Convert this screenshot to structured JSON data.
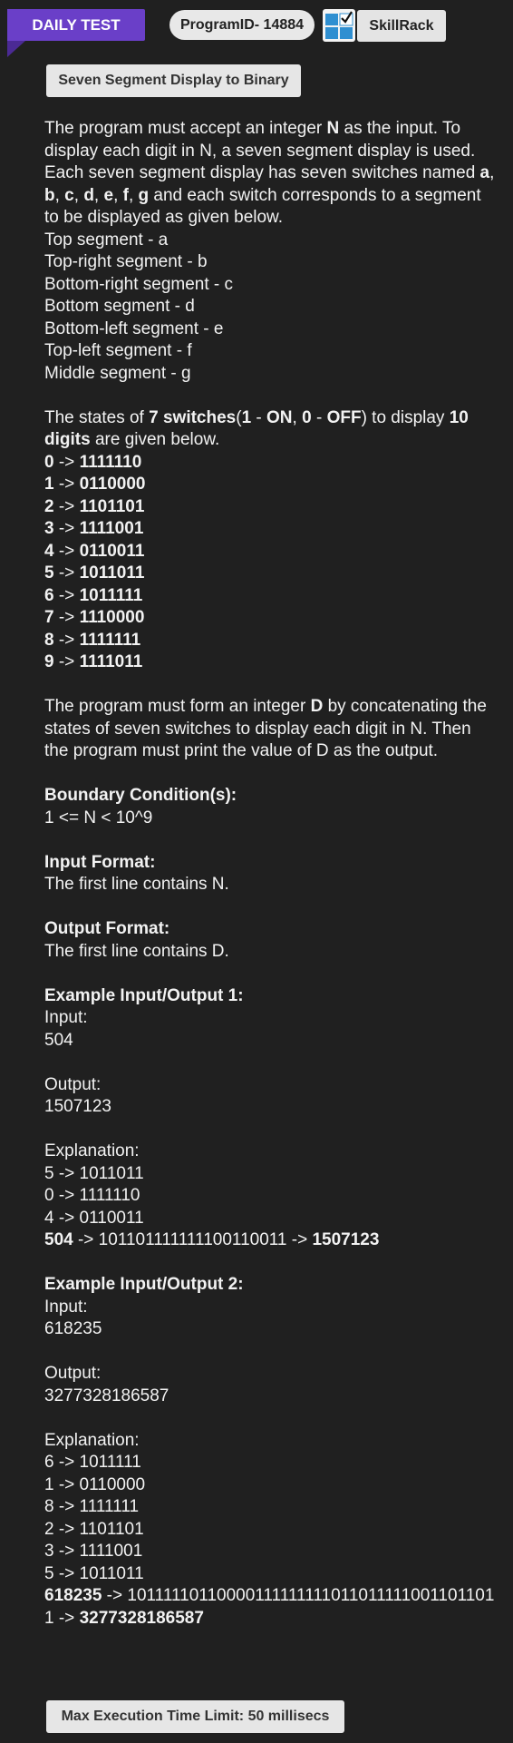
{
  "header": {
    "test_label": "DAILY TEST",
    "program_id": "ProgramID- 14884",
    "brand": "SkillRack"
  },
  "title": "Seven Segment Display to Binary",
  "intro": {
    "t1": "The program must accept an integer ",
    "n": "N",
    "t2": " as the input. To display each digit in N, a seven segment display is used. Each seven segment display has seven switches named ",
    "a": "a",
    "c1": ", ",
    "b": "b",
    "c2": ", ",
    "c": "c",
    "c3": ", ",
    "d": "d",
    "c4": ", ",
    "e": "e",
    "c5": ", ",
    "f": "f",
    "c6": ", ",
    "g": "g",
    "t3": " and each switch corresponds to a segment to be displayed as given below."
  },
  "segments": [
    "Top segment - a",
    "Top-right segment - b",
    "Bottom-right segment - c",
    "Bottom segment - d",
    "Bottom-left segment - e",
    "Top-left segment - f",
    "Middle segment - g"
  ],
  "states_intro": {
    "t1": "The states of ",
    "b1": "7 switches",
    "t2": "(",
    "b2": "1",
    "t3": " - ",
    "b3": "ON",
    "t4": ", ",
    "b4": "0",
    "t5": " - ",
    "b5": "OFF",
    "t6": ") to display ",
    "b6": "10 digits",
    "t7": " are given below."
  },
  "digit_states": [
    {
      "digit": "0",
      "arrow": " -> ",
      "bits": "1111110"
    },
    {
      "digit": "1",
      "arrow": " -> ",
      "bits": "0110000"
    },
    {
      "digit": "2",
      "arrow": " -> ",
      "bits": "1101101"
    },
    {
      "digit": "3",
      "arrow": " -> ",
      "bits": "1111001"
    },
    {
      "digit": "4",
      "arrow": " -> ",
      "bits": "0110011"
    },
    {
      "digit": "5",
      "arrow": " -> ",
      "bits": "1011011"
    },
    {
      "digit": "6",
      "arrow": " -> ",
      "bits": "1011111"
    },
    {
      "digit": "7",
      "arrow": " -> ",
      "bits": "1110000"
    },
    {
      "digit": "8",
      "arrow": " -> ",
      "bits": "1111111"
    },
    {
      "digit": "9",
      "arrow": " -> ",
      "bits": "1111011"
    }
  ],
  "form_text": {
    "t1": "The program must form an integer ",
    "d": "D",
    "t2": " by concatenating the states of seven switches to display each digit in N. Then the program must print the value of D as the output."
  },
  "boundary": {
    "heading": "Boundary Condition(s):",
    "text": "1 <= N < 10^9"
  },
  "input_format": {
    "heading": "Input Format:",
    "text": "The first line contains N."
  },
  "output_format": {
    "heading": "Output Format:",
    "text": "The first line contains D."
  },
  "example1": {
    "heading": "Example Input/Output 1:",
    "input_label": "Input:",
    "input": "504",
    "output_label": "Output:",
    "output": "1507123",
    "explanation_label": "Explanation:",
    "lines": [
      "5 -> 1011011",
      "0 -> 1111110",
      "4 -> 0110011"
    ],
    "final_num": "504",
    "final_mid": " -> 101101111111100110011 -> ",
    "final_res": "1507123"
  },
  "example2": {
    "heading": "Example Input/Output 2:",
    "input_label": "Input:",
    "input": "618235",
    "output_label": "Output:",
    "output": "3277328186587",
    "explanation_label": "Explanation:",
    "lines": [
      "6 -> 1011111",
      "1 -> 0110000",
      "8 -> 1111111",
      "2 -> 1101101",
      "3 -> 1111001",
      "5 -> 1011011"
    ],
    "final_num": "618235",
    "final_mid": " -> 101111101100001111111110110111110011011011 -> ",
    "final_res": "3277328186587"
  },
  "footer": {
    "time_limit": "Max Execution Time Limit: 50 millisecs"
  }
}
